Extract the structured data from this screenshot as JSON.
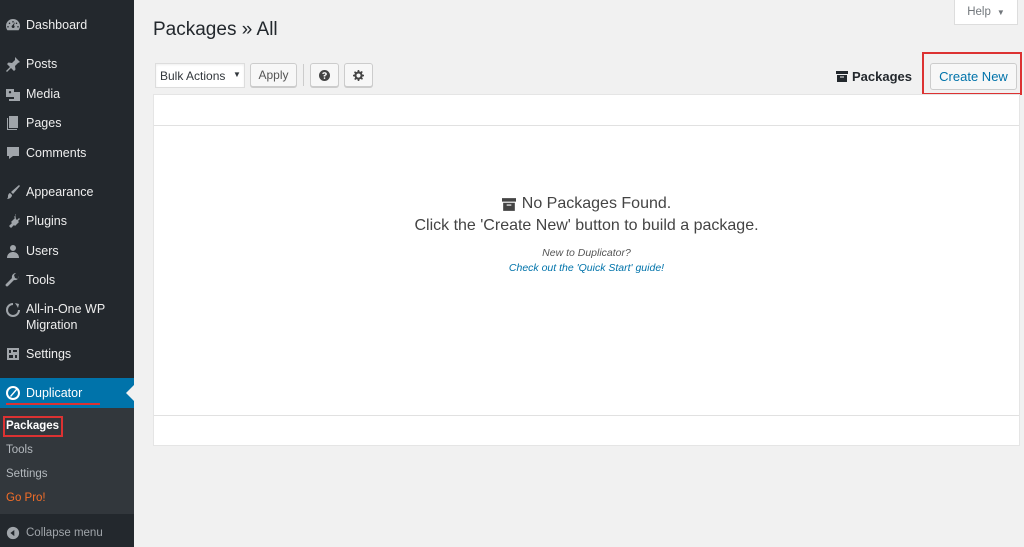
{
  "sidebar": {
    "items": [
      {
        "label": "Dashboard",
        "icon": "dashboard-icon"
      },
      {
        "label": "Posts",
        "icon": "pushpin-icon"
      },
      {
        "label": "Media",
        "icon": "media-icon"
      },
      {
        "label": "Pages",
        "icon": "pages-icon"
      },
      {
        "label": "Comments",
        "icon": "comment-icon"
      },
      {
        "label": "Appearance",
        "icon": "paintbrush-icon"
      },
      {
        "label": "Plugins",
        "icon": "plugin-icon"
      },
      {
        "label": "Users",
        "icon": "users-icon"
      },
      {
        "label": "Tools",
        "icon": "wrench-icon"
      },
      {
        "label": "All-in-One WP Migration",
        "label_line1": "All-in-One WP",
        "label_line2": "Migration",
        "icon": "migration-icon"
      },
      {
        "label": "Settings",
        "icon": "settings-icon"
      },
      {
        "label": "Duplicator",
        "icon": "duplicator-icon"
      }
    ],
    "submenu": [
      {
        "label": "Packages"
      },
      {
        "label": "Tools"
      },
      {
        "label": "Settings"
      },
      {
        "label": "Go Pro!"
      }
    ],
    "collapse_label": "Collapse menu"
  },
  "help": {
    "label": "Help"
  },
  "page": {
    "title": "Packages » All"
  },
  "toolbar": {
    "bulk_actions": "Bulk Actions",
    "apply": "Apply",
    "packages_label": "Packages",
    "create_new": "Create New"
  },
  "empty_state": {
    "line1": "No Packages Found.",
    "line2": "Click the 'Create New' button to build a package.",
    "line3": "New to Duplicator?",
    "link": "Check out the 'Quick Start' guide!"
  },
  "colors": {
    "sidebar_bg": "#23282d",
    "active_menu": "#0073aa",
    "highlight_red": "#dc3232",
    "gopro_orange": "#f56e28",
    "link_blue": "#0073aa"
  }
}
